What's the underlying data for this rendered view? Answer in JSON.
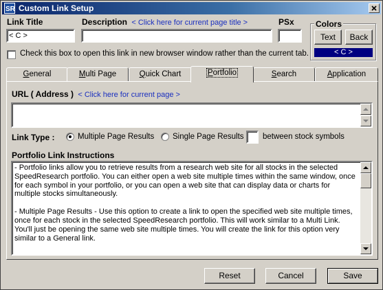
{
  "window": {
    "title": "Custom Link Setup"
  },
  "fields": {
    "link_title_label": "Link Title",
    "link_title_value": "< C >",
    "description_label": "Description",
    "description_link": "< Click here for current page title >",
    "description_value": "",
    "psx_label": "PSx",
    "psx_value": ""
  },
  "colors": {
    "label": "Colors",
    "text_button": "Text",
    "back_button": "Back",
    "preview": "< C >",
    "preview_bg": "#000080",
    "preview_fg": "#ffffff"
  },
  "new_window_checkbox": {
    "label": "Check this box to open this link in new browser window rather than the current tab.",
    "checked": false
  },
  "tabs": [
    {
      "label": "General",
      "u": "G",
      "rest": "eneral"
    },
    {
      "label": "Multi Page",
      "u": "M",
      "rest": "ulti Page"
    },
    {
      "label": "Quick Chart",
      "u": "Q",
      "rest": "uick Chart"
    },
    {
      "label": "Portfolio",
      "u": "P",
      "rest": "ortfolio",
      "active": true
    },
    {
      "label": "Search",
      "u": "S",
      "rest": "earch"
    },
    {
      "label": "Application",
      "u": "A",
      "rest": "pplication"
    }
  ],
  "portfolio": {
    "url_label": "URL ( Address )",
    "url_link": "< Click here for current page >",
    "url_value": "",
    "link_type_label": "Link Type :",
    "option_multiple": "Multiple Page Results",
    "option_single": "Single Page Results -",
    "between_label": "between stock symbols",
    "separator_value": "",
    "selected_option": "multiple",
    "instructions_label": "Portfolio Link Instructions",
    "instructions": [
      "- Portfolio links allow you to retrieve results from a research web site for all stocks in the selected SpeedResearch portfolio.  You can either open a web site multiple times within the same window, once for each symbol in your portfolio, or you can open a web site that can display data or charts for multiple stocks simultaneously.",
      "- Multiple Page Results - Use this option to create a link to open the specified web site multiple times, once for each stock in the selected SpeedResearch portfolio.  This will work similar to a Multi Link.  You'll just be opening the same web site multiple times.  You will create the link for this option very similar to a General link."
    ]
  },
  "buttons": {
    "reset": "Reset",
    "cancel": "Cancel",
    "save": "Save"
  }
}
